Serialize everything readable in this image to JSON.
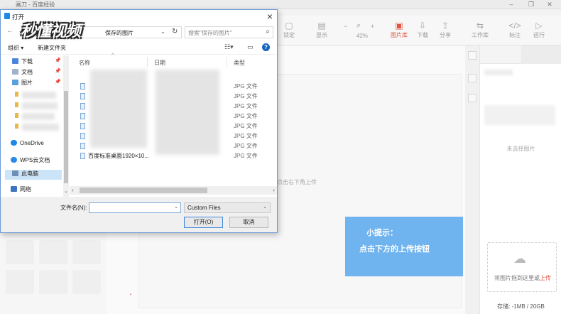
{
  "app": {
    "window_title": "画刀 - 百度经验",
    "toolbar": [
      {
        "label": "锁定",
        "icon": "lock-icon",
        "glyph": "🔒"
      },
      {
        "label": "显示",
        "icon": "layout-icon",
        "glyph": "▤"
      },
      {
        "label": "图片库",
        "icon": "image-library-icon",
        "glyph": "▣",
        "active": true
      },
      {
        "label": "下载",
        "icon": "download-icon",
        "glyph": "⇩"
      },
      {
        "label": "分享",
        "icon": "share-icon",
        "glyph": "⇪"
      },
      {
        "label": "工作库",
        "icon": "workspace-icon",
        "glyph": "⇆"
      },
      {
        "label": "标注",
        "icon": "code-icon",
        "glyph": "</>"
      },
      {
        "label": "运行",
        "icon": "play-icon",
        "glyph": "▷"
      }
    ],
    "zoom": {
      "minus": "−",
      "plus": "+",
      "value": "42%"
    },
    "canvas_hint": "请点击右下角上传",
    "right_panel": {
      "empty_text": "未选择图片",
      "upload_text_prefix": "将图片拖到这里或",
      "upload_link": "上传",
      "storage": "存储: -1MB / 20GB"
    },
    "tip": {
      "line1": "小提示：",
      "line2": "点击下方的上传按钮"
    }
  },
  "dialog": {
    "title": "打开",
    "logo": "秒懂视频",
    "breadcrumb": "保存的图片",
    "search_placeholder": "搜索\"保存的图片\"",
    "commands": {
      "organize": "组织 ▾",
      "new_folder": "新建文件夹"
    },
    "nav": [
      {
        "label": "下载",
        "color": "#d9a92a",
        "pinned": true
      },
      {
        "label": "文档",
        "color": "#d9a92a",
        "pinned": true
      },
      {
        "label": "图片",
        "color": "#d9a92a",
        "pinned": true
      },
      {
        "label": "OneDrive",
        "color": "#1e88e5",
        "pinned": false
      },
      {
        "label": "WPS云文档",
        "color": "#1e88e5",
        "pinned": false
      },
      {
        "label": "此电脑",
        "color": "#5b7fa6",
        "pinned": false,
        "selected": true
      },
      {
        "label": "网络",
        "color": "#3d74c0",
        "pinned": false
      }
    ],
    "columns": {
      "name": "名称",
      "date": "日期",
      "type": "类型"
    },
    "files": [
      {
        "name": "",
        "type": "JPG 文件"
      },
      {
        "name": "",
        "type": "JPG 文件"
      },
      {
        "name": "",
        "type": "JPG 文件"
      },
      {
        "name": "",
        "type": "JPG 文件"
      },
      {
        "name": "",
        "type": "JPG 文件"
      },
      {
        "name": "",
        "type": "JPG 文件"
      },
      {
        "name": "",
        "type": "JPG 文件"
      },
      {
        "name": "百度标准桌面1920×10...",
        "type": "JPG 文件"
      }
    ],
    "filename_label": "文件名(N):",
    "filename_value": "",
    "filetype": "Custom Files",
    "open_button": "打开(O)",
    "cancel_button": "取消"
  }
}
